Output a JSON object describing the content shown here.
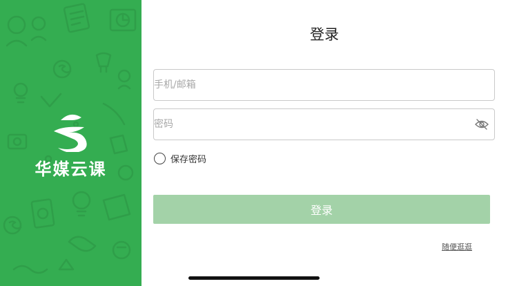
{
  "brand": {
    "name": "华媒云课",
    "panel_color": "#34ad51"
  },
  "form": {
    "title": "登录",
    "account_placeholder": "手机/邮箱",
    "password_placeholder": "密码",
    "remember_label": "保存密码",
    "remember_checked": false,
    "login_label": "登录",
    "browse_label": "随便逛逛",
    "button_color": "#a3d2a8"
  },
  "icons": {
    "password_toggle": "eye-slash-icon",
    "logo": "brand-swirl-logo-icon"
  }
}
